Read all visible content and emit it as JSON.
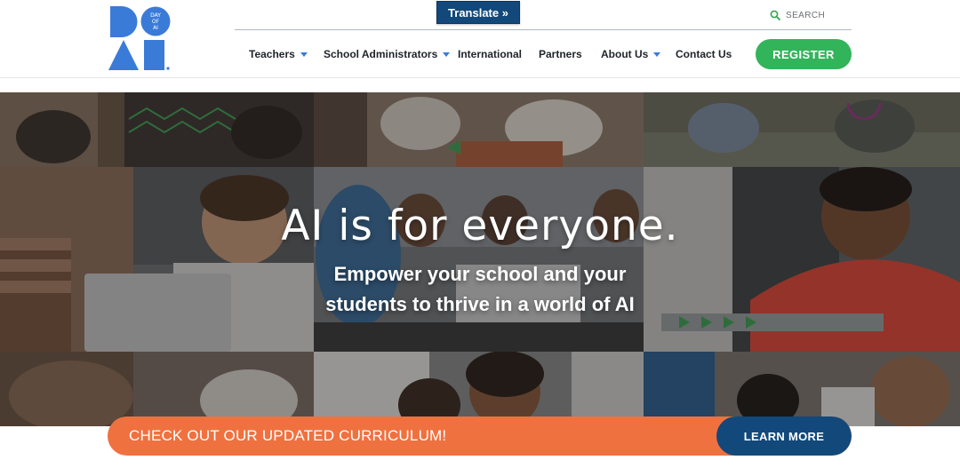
{
  "header": {
    "logo_text": "DAY OF AI",
    "translate_label": "Translate »",
    "search_placeholder": "SEARCH",
    "nav": [
      {
        "label": "Teachers",
        "has_dropdown": true
      },
      {
        "label": "School Administrators",
        "has_dropdown": true
      },
      {
        "label": "International",
        "has_dropdown": false
      },
      {
        "label": "Partners",
        "has_dropdown": false
      },
      {
        "label": "About Us",
        "has_dropdown": true
      },
      {
        "label": "Contact Us",
        "has_dropdown": false
      }
    ],
    "register_label": "REGISTER"
  },
  "hero": {
    "title": "AI is for everyone.",
    "subtitle_line1": "Empower your school and your",
    "subtitle_line2": "students to thrive in a world of AI"
  },
  "banner": {
    "text": "CHECK OUT OUR UPDATED CURRICULUM!",
    "button_label": "LEARN MORE"
  },
  "colors": {
    "brand_blue": "#3b7bd8",
    "navy": "#12497a",
    "register_green": "#32b45a",
    "banner_orange": "#f07140"
  },
  "icons": {
    "search": "search-icon",
    "dropdown": "caret-down-icon",
    "logo": "day-of-ai-logo"
  }
}
